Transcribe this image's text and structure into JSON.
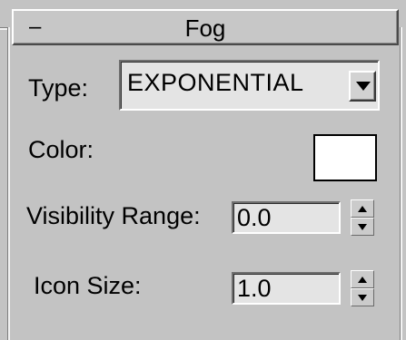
{
  "rollout": {
    "toggle_symbol": "–",
    "title": "Fog"
  },
  "type": {
    "label": "Type:",
    "value": "EXPONENTIAL",
    "dropdown_icon": "triangle-down-icon"
  },
  "color": {
    "label": "Color:",
    "swatch_color": "#ffffff"
  },
  "visibility_range": {
    "label": "Visibility Range:",
    "value": "0.0"
  },
  "icon_size": {
    "label": "Icon Size:",
    "value": "1.0"
  },
  "icons": {
    "spinner_up": "spinner-up-icon",
    "spinner_down": "spinner-down-icon"
  }
}
